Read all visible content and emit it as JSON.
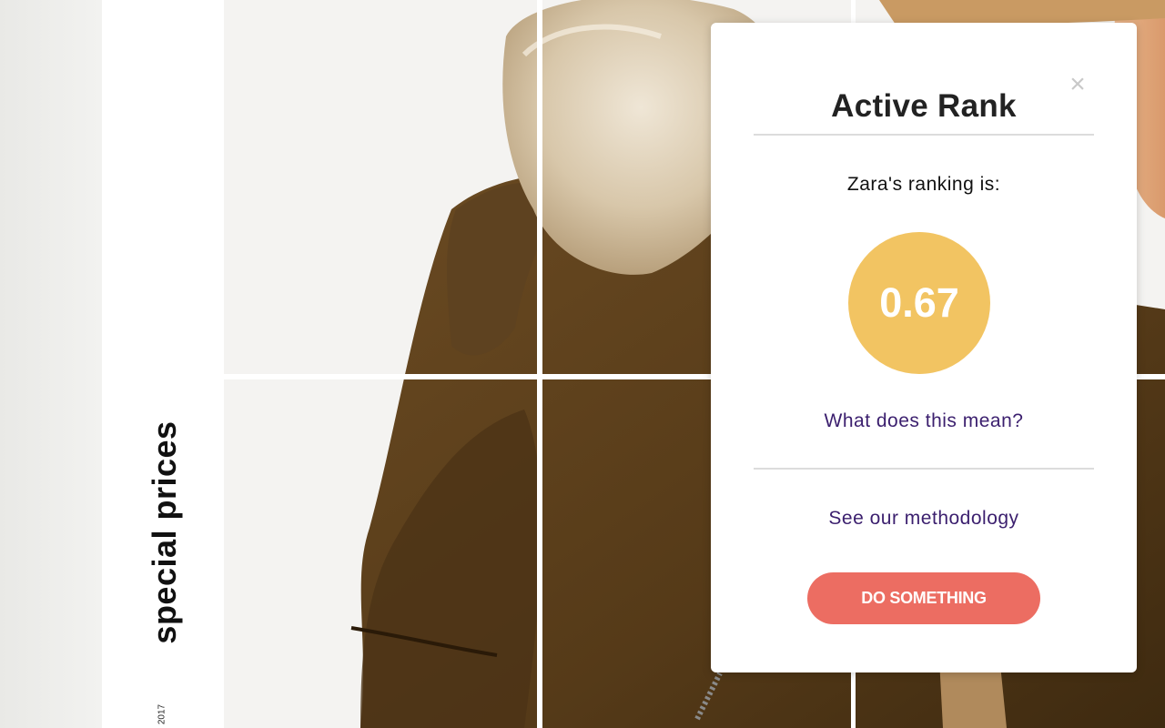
{
  "side_banner": {
    "text": "special prices",
    "year_text": "2017"
  },
  "popup": {
    "title": "Active Rank",
    "close_symbol": "×",
    "ranking_label": "Zara's ranking is:",
    "score": "0.67",
    "meaning_link": "What does this mean?",
    "methodology_link": "See our methodology",
    "cta_label": "DO SOMETHING"
  },
  "colors": {
    "score_circle": "#f2c462",
    "cta": "#ec6d62",
    "link": "#3b1f6e"
  },
  "icons": [
    "close-icon"
  ]
}
